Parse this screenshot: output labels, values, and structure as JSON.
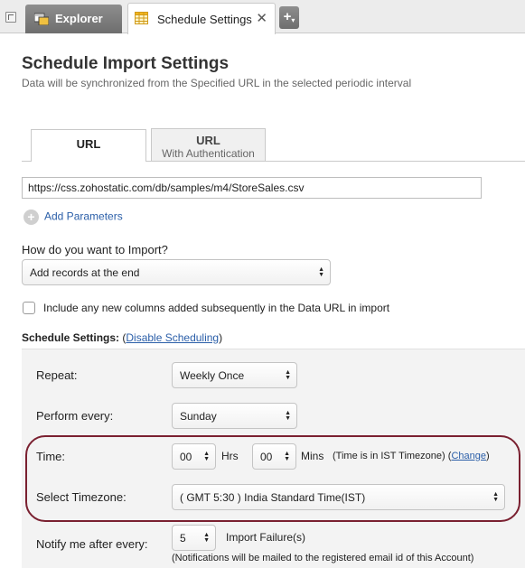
{
  "tabs": {
    "explorer_label": "Explorer",
    "active_label": "Schedule Settings",
    "close_glyph": "✕",
    "add_glyph": "+"
  },
  "header": {
    "title": "Schedule Import Settings",
    "subtitle": "Data will be synchronized from the Specified URL in the selected periodic interval"
  },
  "url_tabs": [
    {
      "label": "URL",
      "sub": ""
    },
    {
      "label": "URL",
      "sub": "With Authentication"
    }
  ],
  "url_input": {
    "value": "https://css.zohostatic.com/db/samples/m4/StoreSales.csv"
  },
  "add_parameters": {
    "label": "Add Parameters"
  },
  "import": {
    "question": "How do you want to Import?",
    "selected": "Add records at the end"
  },
  "include_columns": {
    "label": "Include any new columns added subsequently in the Data URL in import",
    "checked": false
  },
  "schedule": {
    "heading": "Schedule Settings:",
    "open_paren": "(",
    "disable_link": "Disable Scheduling",
    "close_paren": ")",
    "repeat_label": "Repeat:",
    "repeat_value": "Weekly Once",
    "perform_label": "Perform every:",
    "perform_value": "Sunday",
    "time_label": "Time:",
    "hours_value": "00",
    "hrs_label": "Hrs",
    "mins_value": "00",
    "mins_label": "Mins",
    "timezone_note": "(Time is in IST Timezone)",
    "change_link": "Change",
    "timezone_label": "Select Timezone:",
    "timezone_value": "( GMT 5:30 ) India Standard Time(IST)",
    "notify_label": "Notify me after every:",
    "notify_value": "5",
    "notify_suffix": "Import Failure(s)",
    "notify_note": "(Notifications will be mailed to the registered email id of this Account)"
  },
  "colors": {
    "link": "#2a5ea8",
    "highlight_border": "#7a2030",
    "panel_bg": "#f3f3f3"
  },
  "icons": {
    "pin": "pin-icon",
    "explorer": "explorer-icon",
    "sheet": "spreadsheet-icon",
    "close": "close-icon",
    "add": "add-tab-icon",
    "plus": "plus-circle-icon",
    "updown": "updown-arrows-icon"
  }
}
